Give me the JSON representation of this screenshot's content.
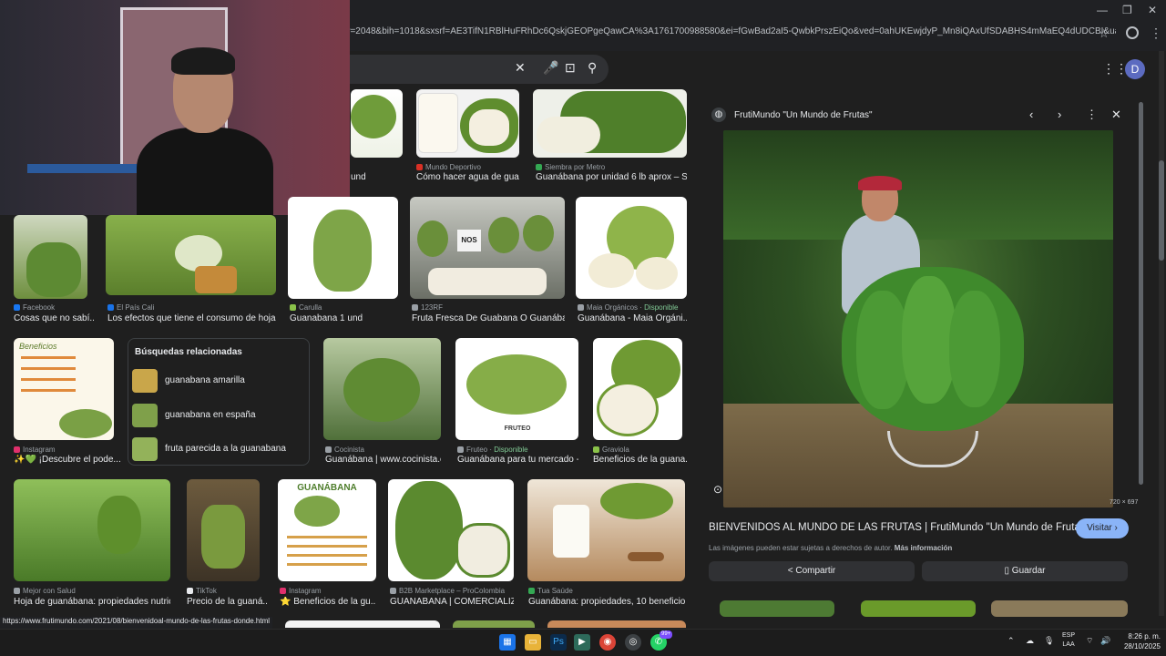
{
  "browser": {
    "url": "iw=2048&bih=1018&sxsrf=AE3TifN1RBlHuFRhDc6QskjGEOPgeQawCA%3A1761700988580&ei=fGwBad2aI5-QwbkPrszEiQo&ved=0ahUKEwjdyP_Mn8iQAxUfSDABHS4mMaEQ4dUDCBI&uact=5&oq=guanabana&...",
    "avatar_letter": "D"
  },
  "results": {
    "row0": [
      {
        "source": "",
        "caption": "und"
      },
      {
        "source": "Mundo Deportivo",
        "caption": "Cómo hacer agua de gua..."
      },
      {
        "source": "Siembra por Metro",
        "caption": "Guanábana por unidad 6 lb aprox – Si..."
      }
    ],
    "row1": [
      {
        "source": "Facebook",
        "caption": "Cosas que no sabí..."
      },
      {
        "source": "El País Cali",
        "caption": "Los efectos que tiene el consumo de hojas..."
      },
      {
        "source": "Carulla",
        "caption": "Guanabana 1 und"
      },
      {
        "source": "123RF",
        "caption": "Fruta Fresca De Guabana O Guanába..."
      },
      {
        "source": "Maia Orgánicos",
        "available": "Disponible",
        "caption": "Guanábana - Maia Orgáni..."
      }
    ],
    "row2": [
      {
        "source": "Instagram",
        "caption": "✨💚 ¡Descubre el pode..."
      },
      {
        "source": "Cocinista",
        "caption": "Guanábana | www.cocinista.es"
      },
      {
        "source": "Fruteo",
        "available": "Disponible",
        "caption": "Guanábana para tu mercado -..."
      },
      {
        "source": "Graviola",
        "caption": "Beneficios de la guana..."
      }
    ],
    "row3": [
      {
        "source": "Mejor con Salud",
        "caption": "Hoja de guanábana: propiedades nutrici..."
      },
      {
        "source": "TikTok",
        "caption": "Precio de la guaná..."
      },
      {
        "source": "Instagram",
        "caption": "⭐ Beneficios de la gu..."
      },
      {
        "source": "B2B Marketplace – ProColombia",
        "caption": "GUANABANA | COMERCIALIZ..."
      },
      {
        "source": "Tua Saúde",
        "caption": "Guanábana: propiedades, 10 beneficios ..."
      }
    ],
    "tile_texts": {
      "beneficios": "Beneficios",
      "guanabana_card": "GUANÁBANA",
      "fruteo_brand": "FRUTEO",
      "nos_sign": "NOS"
    }
  },
  "related": {
    "title": "Búsquedas relacionadas",
    "items": [
      {
        "label": "guanabana amarilla"
      },
      {
        "label": "guanabana en españa"
      },
      {
        "label": "fruta parecida a la guanabana"
      }
    ]
  },
  "preview": {
    "site": "FrutiMundo \"Un Mundo de Frutas\"",
    "dims": "720 × 697",
    "title": "BIENVENIDOS AL MUNDO DE LAS FRUTAS | FrutiMundo \"Un Mundo de Frutas\"",
    "visit_label": "Visitar",
    "note": "Las imágenes pueden estar sujetas a derechos de autor.",
    "more_info": "Más información",
    "share_label": "Compartir",
    "save_label": "Guardar"
  },
  "status_url": "https://www.frutimundo.com/2021/08/bienvenidoal-mundo-de-las-frutas-donde.html",
  "taskbar": {
    "lang1": "ESP",
    "lang2": "LAA",
    "time": "8:26 p. m.",
    "date": "28/10/2025",
    "badge": "99+"
  },
  "colors": {
    "accent": "#8ab4f8",
    "available": "#81c995",
    "background": "#1f1f1f"
  }
}
